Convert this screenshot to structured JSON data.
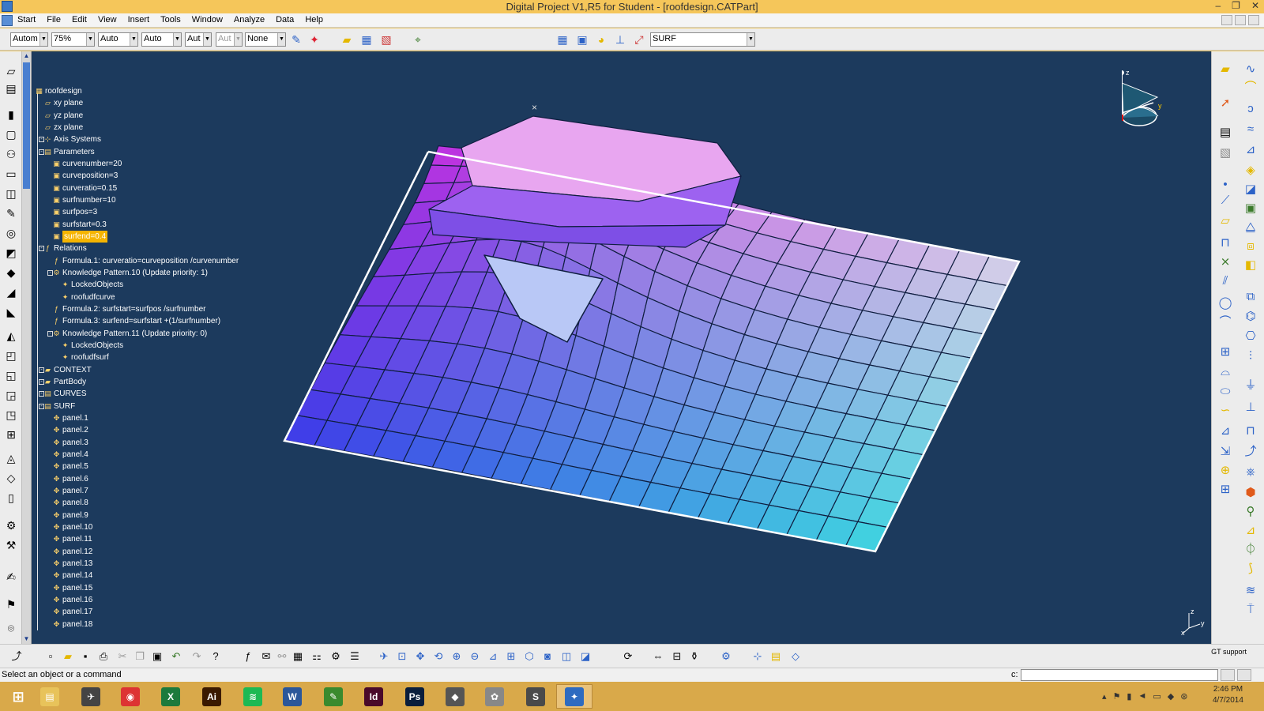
{
  "window": {
    "title": "Digital Project V1,R5 for Student - [roofdesign.CATPart]",
    "controls": [
      "–",
      "❐",
      "✕"
    ]
  },
  "menu": {
    "items": [
      "Start",
      "File",
      "Edit",
      "View",
      "Insert",
      "Tools",
      "Window",
      "Analyze",
      "Data",
      "Help"
    ]
  },
  "toolbar": {
    "combo_color": "Autom",
    "combo_transparency": "75%",
    "combo_linetype": "Auto",
    "combo_linewidth": "Auto",
    "combo_a": "Aut",
    "combo_b": "Aut",
    "combo_layer": "None",
    "combo_current": "SURF"
  },
  "tree": {
    "nodes": [
      {
        "label": "roofdesign",
        "level": 0,
        "icon": "part-icon"
      },
      {
        "label": "xy plane",
        "level": 1,
        "icon": "plane-icon"
      },
      {
        "label": "yz plane",
        "level": 1,
        "icon": "plane-icon"
      },
      {
        "label": "zx plane",
        "level": 1,
        "icon": "plane-icon"
      },
      {
        "label": "Axis Systems",
        "level": 1,
        "icon": "axis-icon"
      },
      {
        "label": "Parameters",
        "level": 1,
        "icon": "parameters-icon"
      },
      {
        "label": "curvenumber=20",
        "level": 2,
        "icon": "parameter-icon"
      },
      {
        "label": "curveposition=3",
        "level": 2,
        "icon": "parameter-icon"
      },
      {
        "label": "curveratio=0.15",
        "level": 2,
        "icon": "parameter-icon"
      },
      {
        "label": "surfnumber=10",
        "level": 2,
        "icon": "parameter-icon"
      },
      {
        "label": "surfpos=3",
        "level": 2,
        "icon": "parameter-icon"
      },
      {
        "label": "surfstart=0.3",
        "level": 2,
        "icon": "parameter-icon"
      },
      {
        "label": "surfend=0.4",
        "level": 2,
        "icon": "parameter-icon",
        "selected": true
      },
      {
        "label": "Relations",
        "level": 1,
        "icon": "relations-icon"
      },
      {
        "label": "Formula.1: curveratio=curveposition /curvenumber",
        "level": 2,
        "icon": "formula-icon"
      },
      {
        "label": "Knowledge Pattern.10 (Update priority: 1)",
        "level": 2,
        "icon": "pattern-icon"
      },
      {
        "label": "LockedObjects",
        "level": 3,
        "icon": "locked-icon"
      },
      {
        "label": "roofudfcurve",
        "level": 3,
        "icon": "udf-icon"
      },
      {
        "label": "Formula.2: surfstart=surfpos /surfnumber",
        "level": 2,
        "icon": "formula-icon"
      },
      {
        "label": "Formula.3: surfend=surfstart +(1/surfnumber)",
        "level": 2,
        "icon": "formula-icon"
      },
      {
        "label": "Knowledge Pattern.11 (Update priority: 0)",
        "level": 2,
        "icon": "pattern-icon"
      },
      {
        "label": "LockedObjects",
        "level": 3,
        "icon": "locked-icon"
      },
      {
        "label": "roofudfsurf",
        "level": 3,
        "icon": "udf-icon"
      },
      {
        "label": "CONTEXT",
        "level": 1,
        "icon": "context-icon"
      },
      {
        "label": "PartBody",
        "level": 1,
        "icon": "body-icon"
      },
      {
        "label": "CURVES",
        "level": 1,
        "icon": "set-icon"
      },
      {
        "label": "SURF",
        "level": 1,
        "icon": "set-icon"
      },
      {
        "label": "panel.1",
        "level": 2,
        "icon": "panel-icon"
      },
      {
        "label": "panel.2",
        "level": 2,
        "icon": "panel-icon"
      },
      {
        "label": "panel.3",
        "level": 2,
        "icon": "panel-icon"
      },
      {
        "label": "panel.4",
        "level": 2,
        "icon": "panel-icon"
      },
      {
        "label": "panel.5",
        "level": 2,
        "icon": "panel-icon"
      },
      {
        "label": "panel.6",
        "level": 2,
        "icon": "panel-icon"
      },
      {
        "label": "panel.7",
        "level": 2,
        "icon": "panel-icon"
      },
      {
        "label": "panel.8",
        "level": 2,
        "icon": "panel-icon"
      },
      {
        "label": "panel.9",
        "level": 2,
        "icon": "panel-icon"
      },
      {
        "label": "panel.10",
        "level": 2,
        "icon": "panel-icon"
      },
      {
        "label": "panel.11",
        "level": 2,
        "icon": "panel-icon"
      },
      {
        "label": "panel.12",
        "level": 2,
        "icon": "panel-icon"
      },
      {
        "label": "panel.13",
        "level": 2,
        "icon": "panel-icon"
      },
      {
        "label": "panel.14",
        "level": 2,
        "icon": "panel-icon"
      },
      {
        "label": "panel.15",
        "level": 2,
        "icon": "panel-icon"
      },
      {
        "label": "panel.16",
        "level": 2,
        "icon": "panel-icon"
      },
      {
        "label": "panel.17",
        "level": 2,
        "icon": "panel-icon"
      },
      {
        "label": "panel.18",
        "level": 2,
        "icon": "panel-icon"
      }
    ]
  },
  "compass": {
    "z": "z",
    "y": "y"
  },
  "axis_mini": {
    "z": "z",
    "y": "y",
    "x": "x"
  },
  "bottom": {
    "gt_support": "GT support"
  },
  "status": {
    "message": "Select an object or a command",
    "command_label": "c:"
  },
  "taskbar": {
    "apps": [
      {
        "name": "file-explorer-icon",
        "glyph": "▤",
        "color": "#e8c35a"
      },
      {
        "name": "catia-icon",
        "glyph": "✈",
        "color": "#444"
      },
      {
        "name": "chrome-icon",
        "glyph": "◉",
        "color": "#d33"
      },
      {
        "name": "excel-icon",
        "glyph": "X",
        "color": "#1d7a3c"
      },
      {
        "name": "illustrator-icon",
        "glyph": "Ai",
        "color": "#3b1a00"
      },
      {
        "name": "spotify-icon",
        "glyph": "≋",
        "color": "#1db954"
      },
      {
        "name": "word-icon",
        "glyph": "W",
        "color": "#2b579a"
      },
      {
        "name": "project-icon",
        "glyph": "✎",
        "color": "#3a8a2e"
      },
      {
        "name": "indesign-icon",
        "glyph": "Id",
        "color": "#4a0a2a"
      },
      {
        "name": "photoshop-icon",
        "glyph": "Ps",
        "color": "#0a1e3c"
      },
      {
        "name": "rhino-icon",
        "glyph": "◆",
        "color": "#555"
      },
      {
        "name": "paint-icon",
        "glyph": "✿",
        "color": "#888"
      },
      {
        "name": "sublime-icon",
        "glyph": "S",
        "color": "#4a4a4a"
      },
      {
        "name": "digital-project-icon",
        "glyph": "✦",
        "color": "#2e6bc0"
      }
    ],
    "time": "2:46 PM",
    "date": "4/7/2014"
  },
  "colors": {
    "viewport_bg": "#1c3a5d",
    "selection": "#f5b400",
    "taskbar": "#d9a94a"
  }
}
